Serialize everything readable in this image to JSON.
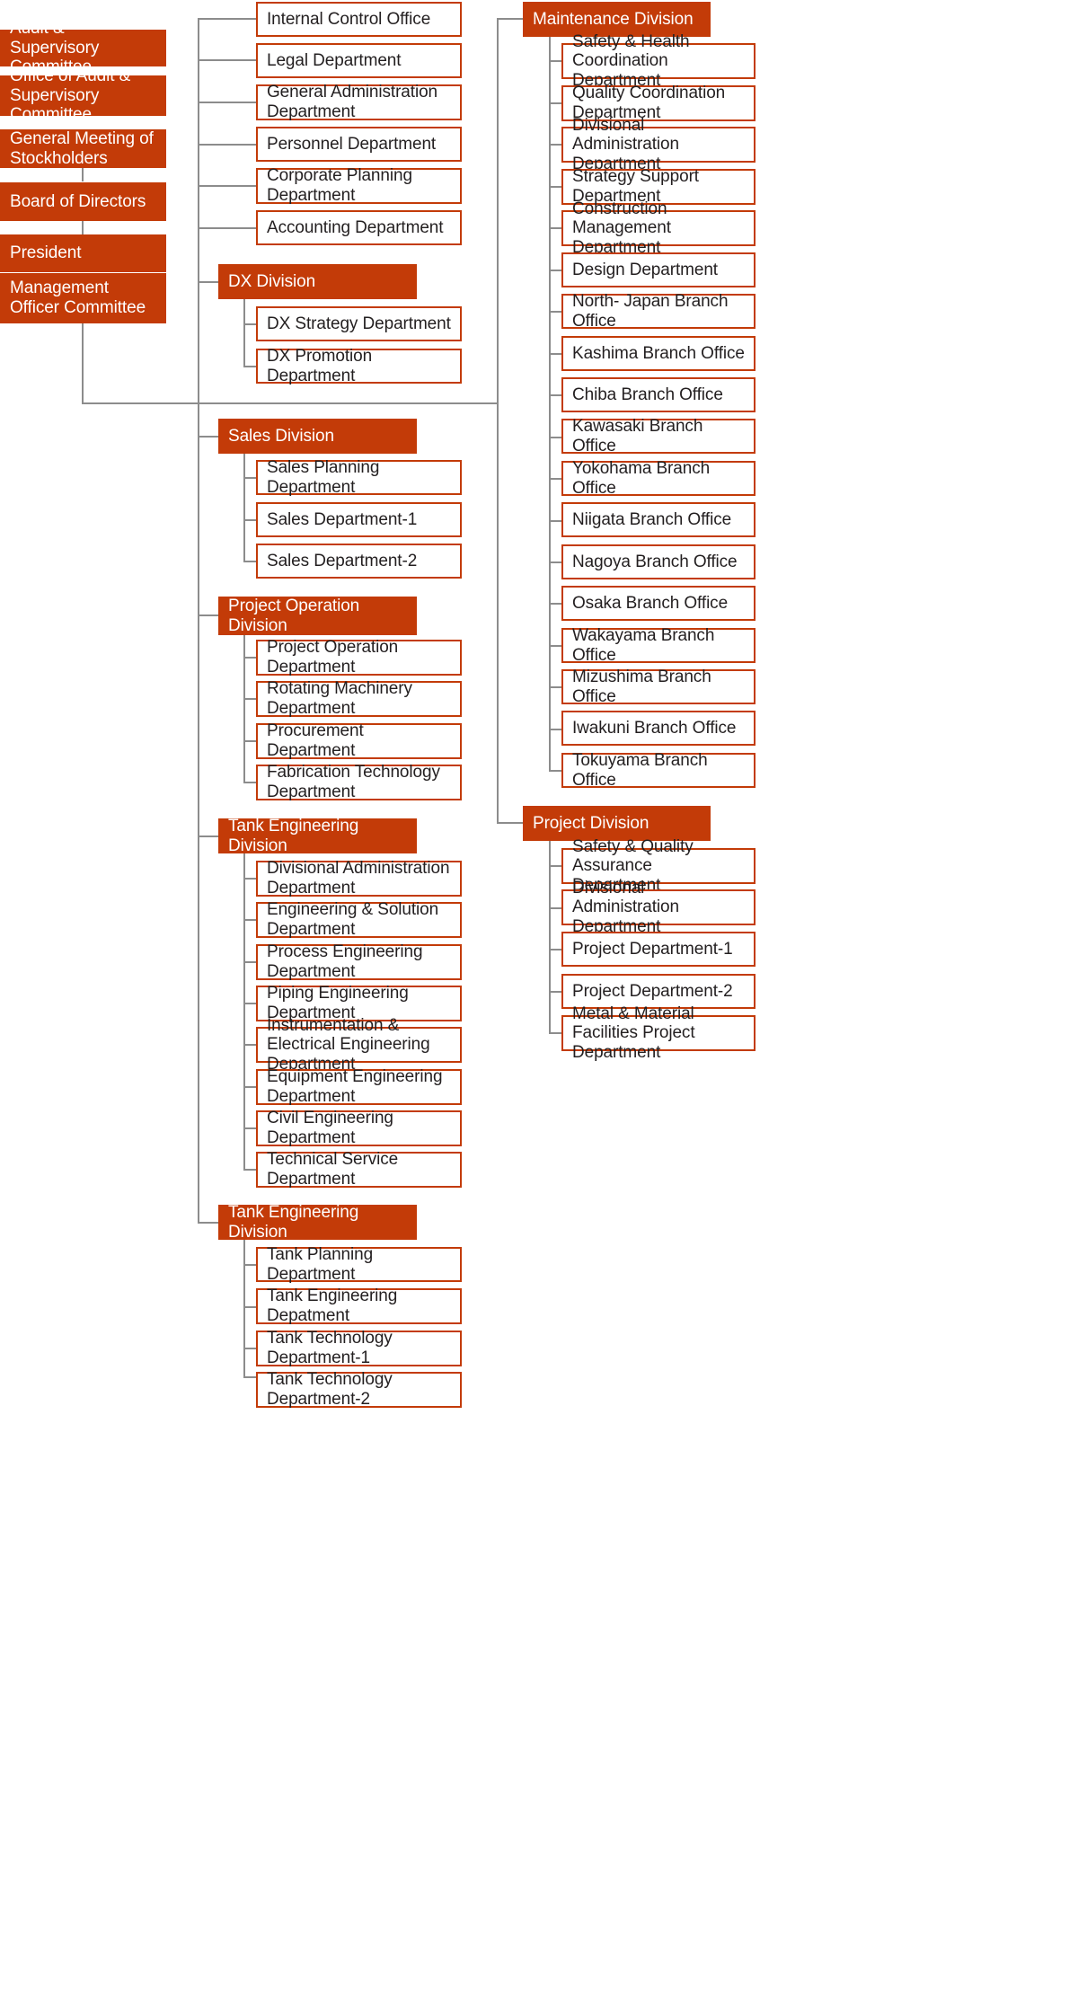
{
  "palette": {
    "brand_orange": "#c33b08",
    "line_gray": "#8c8c8c",
    "text_dark": "#231f20",
    "text_light": "#ffffff",
    "background": "#ffffff"
  },
  "governance": {
    "audit_supervisory_committee": "Audit & Supervisory Committee",
    "office_of_audit_supervisory_committee": "Office of Audit & Supervisory Committee",
    "general_meeting_of_stockholders": "General Meeting of Stockholders",
    "board_of_directors": "Board of Directors",
    "president": "President",
    "management_officer_committee": "Management Officer Committee"
  },
  "corporate_departments": [
    "Internal Control Office",
    "Legal Department",
    "General Administration Department",
    "Personnel Department",
    "Corporate Planning Department",
    "Accounting Department"
  ],
  "divisions": {
    "dx": {
      "title": "DX Division",
      "departments": [
        "DX Strategy Department",
        "DX Promotion Department"
      ]
    },
    "sales": {
      "title": "Sales Division",
      "departments": [
        "Sales Planning Department",
        "Sales Department-1",
        "Sales Department-2"
      ]
    },
    "project_operation": {
      "title": "Project Operation Division",
      "departments": [
        "Project Operation Department",
        "Rotating Machinery Department",
        "Procurement Department",
        "Fabrication Technology Department"
      ]
    },
    "tank_engineering_a": {
      "title": "Tank Engineering Division",
      "departments": [
        "Divisional Administration Department",
        "Engineering &  Solution Department",
        "Process Engineering Department",
        "Piping Engineering Department",
        "Instrumentation & Electrical Engineering Department",
        "Equipment Engineering Department",
        "Civil Engineering Department",
        "Technical Service Department"
      ]
    },
    "tank_engineering_b": {
      "title": "Tank Engineering Division",
      "departments": [
        "Tank Planning Department",
        "Tank Engineering Depatment",
        "Tank Technology Department-1",
        "Tank Technology Department-2"
      ]
    },
    "maintenance": {
      "title": "Maintenance Division",
      "departments": [
        "Safety & Health Coordination Department",
        "Quality Coordination Department",
        "Divisional Administration Department",
        "Strategy Support Department",
        "Construction Management Department",
        "Design Department",
        "North- Japan Branch Office",
        "Kashima Branch Office",
        "Chiba Branch Office",
        "Kawasaki Branch Office",
        "Yokohama Branch Office",
        "Niigata Branch Office",
        "Nagoya Branch Office",
        "Osaka Branch Office",
        "Wakayama Branch Office",
        "Mizushima Branch Office",
        "Iwakuni Branch Office",
        "Tokuyama Branch Office"
      ]
    },
    "project": {
      "title": "Project Division",
      "departments": [
        "Safety & Quality Assurance Department",
        "Divisional Administration Department",
        "Project Department-1",
        "Project Department-2",
        "Metal & Material Facilities Project Department"
      ]
    }
  }
}
